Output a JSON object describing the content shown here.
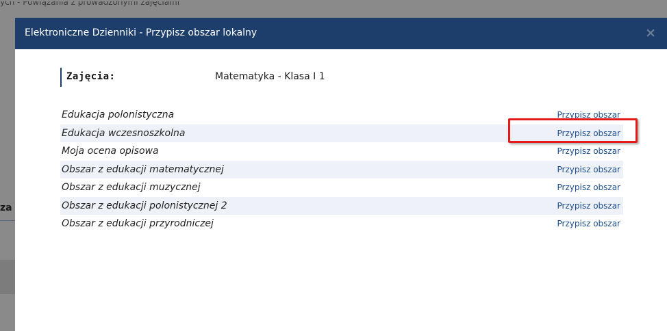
{
  "background": {
    "breadcrumb": "ych - Powiązania z prowadzonymi zajęciami",
    "partial_label": "za"
  },
  "dialog": {
    "title": "Elektroniczne Dzienniki - Przypisz obszar lokalny",
    "close_glyph": "×"
  },
  "subject": {
    "label": "Zajęcia:",
    "value": "Matematyka - Klasa I 1"
  },
  "areas": [
    {
      "name": "Edukacja polonistyczna",
      "action": "Przypisz obszar"
    },
    {
      "name": "Edukacja wczesnoszkolna",
      "action": "Przypisz obszar"
    },
    {
      "name": "Moja ocena opisowa",
      "action": "Przypisz obszar"
    },
    {
      "name": "Obszar z edukacji matematycznej",
      "action": "Przypisz obszar"
    },
    {
      "name": "Obszar z edukacji muzycznej",
      "action": "Przypisz obszar"
    },
    {
      "name": "Obszar z edukacji polonistycznej 2",
      "action": "Przypisz obszar"
    },
    {
      "name": "Obszar z edukacji przyrodniczej",
      "action": "Przypisz obszar"
    }
  ],
  "colors": {
    "titlebar": "#1d3e6b",
    "link": "#1c4d8a",
    "row_alt": "#eef1f8",
    "highlight": "#e31b1b",
    "overlay": "#8a8a8a"
  },
  "icons": {
    "close": "close-icon"
  }
}
